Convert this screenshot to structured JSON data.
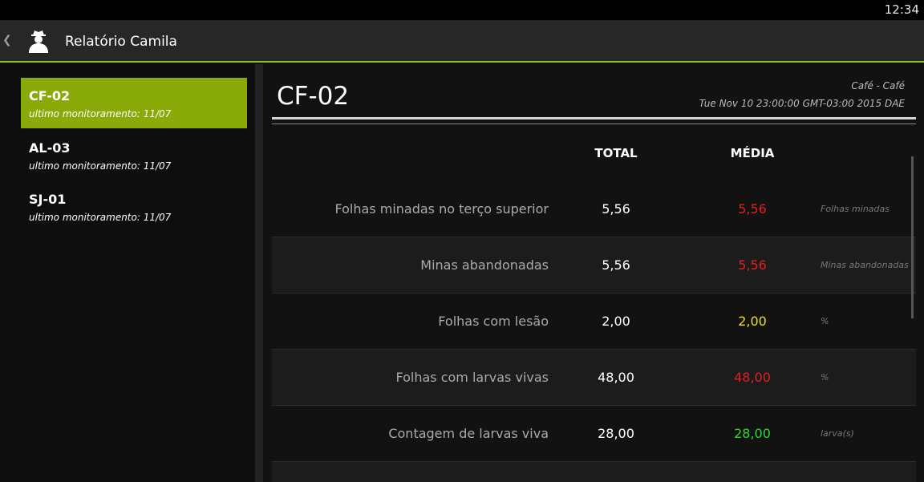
{
  "status_bar": {
    "clock": "12:34"
  },
  "action_bar": {
    "title": "Relatório Camila",
    "app_icon": "person-icon",
    "up_icon": "chevron-left-icon"
  },
  "sidebar": {
    "items": [
      {
        "code": "CF-02",
        "subtitle": "ultimo monitoramento: 11/07",
        "selected": true
      },
      {
        "code": "AL-03",
        "subtitle": "ultimo monitoramento: 11/07",
        "selected": false
      },
      {
        "code": "SJ-01",
        "subtitle": "ultimo monitoramento: 11/07",
        "selected": false
      }
    ]
  },
  "detail": {
    "code": "CF-02",
    "crop": "Café - Café",
    "date": "Tue Nov 10 23:00:00 GMT-03:00 2015 DAE",
    "columns": {
      "total": "TOTAL",
      "media": "MÉDIA"
    },
    "rows": [
      {
        "label": "Folhas minadas no terço superior",
        "total": "5,56",
        "media": "5,56",
        "media_color": "#e02020",
        "unit": "Folhas minadas"
      },
      {
        "label": "Minas abandonadas",
        "total": "5,56",
        "media": "5,56",
        "media_color": "#e02020",
        "unit": "Minas abandonadas"
      },
      {
        "label": "Folhas com lesão",
        "total": "2,00",
        "media": "2,00",
        "media_color": "#e8e020",
        "unit": "%"
      },
      {
        "label": "Folhas com larvas vivas",
        "total": "48,00",
        "media": "48,00",
        "media_color": "#e02020",
        "unit": "%"
      },
      {
        "label": "Contagem de larvas viva",
        "total": "28,00",
        "media": "28,00",
        "media_color": "#2ed82e",
        "unit": "larva(s)"
      }
    ]
  },
  "colors": {
    "accent": "#8ec21f",
    "selected_item": "#8aaa0a"
  }
}
